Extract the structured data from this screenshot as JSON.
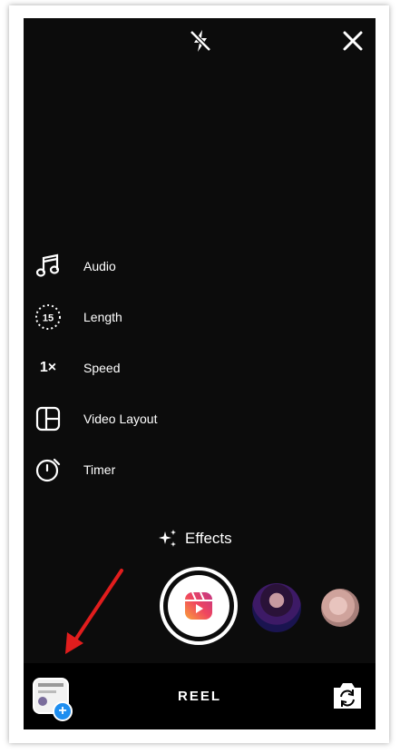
{
  "top_bar": {
    "flash_icon": "flash-off-icon",
    "close_icon": "close-icon"
  },
  "tools": [
    {
      "label": "Audio",
      "icon": "music-note-icon"
    },
    {
      "label": "Length",
      "icon": "length-timer-icon",
      "badge": "15"
    },
    {
      "label": "Speed",
      "icon": "speed-icon",
      "badge": "1×"
    },
    {
      "label": "Video Layout",
      "icon": "layout-icon"
    },
    {
      "label": "Timer",
      "icon": "timer-icon"
    }
  ],
  "effects": {
    "label": "Effects",
    "icon": "sparkle-icon"
  },
  "capture": {
    "icon": "reels-icon"
  },
  "bottom_bar": {
    "mode_label": "REEL",
    "gallery_badge": "+",
    "flip_icon": "flip-camera-icon"
  },
  "colors": {
    "background": "#000000",
    "badge_blue": "#1e8ef0",
    "arrow_red": "#e11d1d",
    "reels_gradient_start": "#f77737",
    "reels_gradient_end": "#c13584"
  }
}
